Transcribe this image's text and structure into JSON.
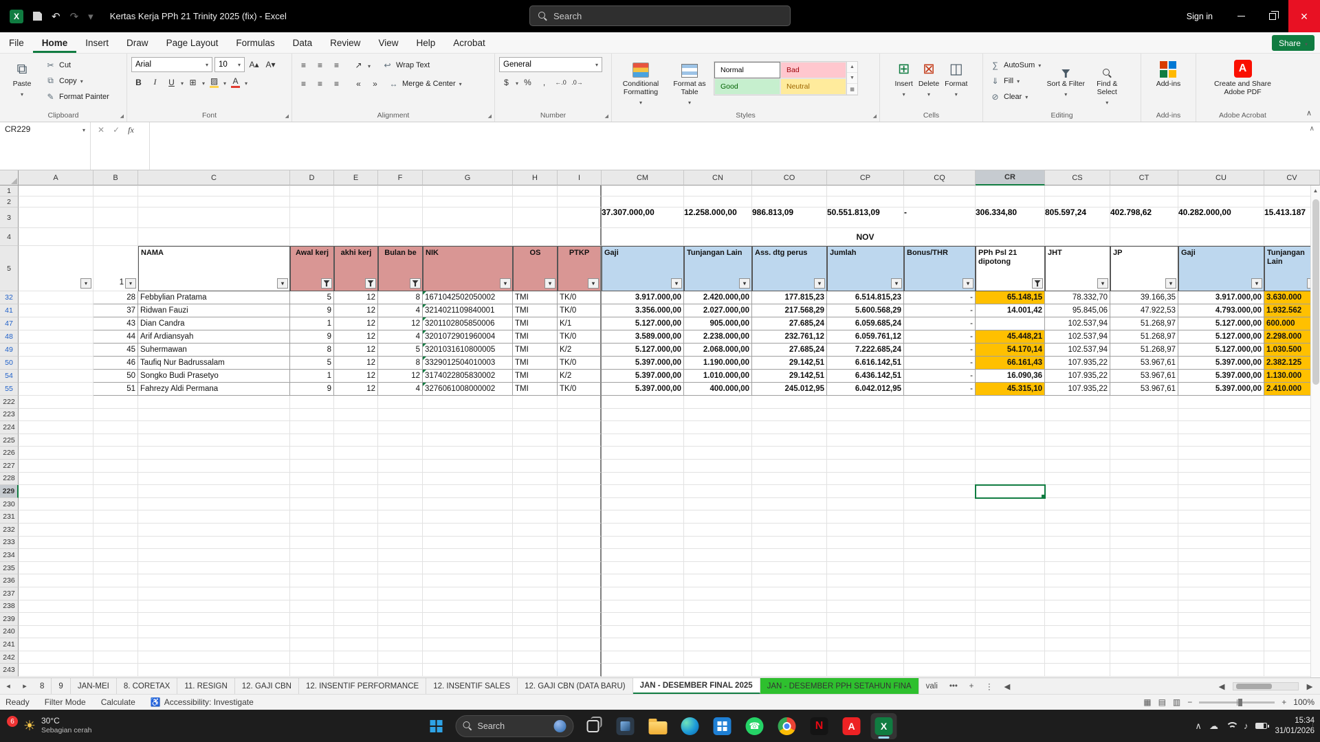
{
  "titlebar": {
    "title": "Kertas Kerja PPh 21 Trinity 2025 (fix)  -  Excel",
    "search_placeholder": "Search",
    "sign_in": "Sign in"
  },
  "menubar": {
    "items": [
      "File",
      "Home",
      "Insert",
      "Draw",
      "Page Layout",
      "Formulas",
      "Data",
      "Review",
      "View",
      "Help",
      "Acrobat"
    ],
    "active": "Home",
    "share": "Share"
  },
  "ribbon": {
    "clipboard": {
      "paste": "Paste",
      "cut": "Cut",
      "copy": "Copy",
      "format_painter": "Format Painter",
      "label": "Clipboard"
    },
    "font": {
      "name": "Arial",
      "size": "10",
      "label": "Font"
    },
    "alignment": {
      "wrap": "Wrap Text",
      "merge": "Merge & Center",
      "label": "Alignment"
    },
    "number": {
      "format": "General",
      "label": "Number"
    },
    "styles": {
      "conditional": "Conditional Formatting",
      "format_table": "Format as Table",
      "gallery": [
        "Normal",
        "Bad",
        "Good",
        "Neutral"
      ],
      "label": "Styles"
    },
    "cells": {
      "insert": "Insert",
      "delete": "Delete",
      "format": "Format",
      "label": "Cells"
    },
    "editing": {
      "autosum": "AutoSum",
      "fill": "Fill",
      "clear": "Clear",
      "sort": "Sort & Filter",
      "find": "Find & Select",
      "label": "Editing"
    },
    "addins": {
      "button": "Add-ins",
      "label": "Add-ins"
    },
    "adobe": {
      "button": "Create and Share Adobe PDF",
      "label": "Adobe Acrobat"
    }
  },
  "formula_bar": {
    "name_box": "CR229",
    "formula": ""
  },
  "sheet": {
    "columns": [
      "A",
      "B",
      "C",
      "D",
      "E",
      "F",
      "G",
      "H",
      "I",
      "CM",
      "CN",
      "CO",
      "CP",
      "CQ",
      "CR",
      "CS",
      "CT",
      "CU",
      "CV"
    ],
    "selection": {
      "col": "CR",
      "row": 229
    },
    "blank_rows": [
      "1",
      "2"
    ],
    "totals": {
      "row": "3",
      "values": {
        "CM": "37.307.000,00",
        "CN": "12.258.000,00",
        "CO": "986.813,09",
        "CP": "50.551.813,09",
        "CQ": "-",
        "CR": "306.334,80",
        "CS": "805.597,24",
        "CT": "402.798,62",
        "CU": "40.282.000,00",
        "CV": "15.413.187"
      }
    },
    "month": {
      "row": "4",
      "col": "CP",
      "label": "NOV"
    },
    "header": {
      "row": "5",
      "cells": [
        {
          "col": "A",
          "label": "",
          "style": "plain",
          "filter": "arrow"
        },
        {
          "col": "B",
          "label": "1",
          "style": "plain",
          "filter": "arrow"
        },
        {
          "col": "C",
          "label": "NAMA",
          "style": "white left",
          "filter": "arrow"
        },
        {
          "col": "D",
          "label": "Awal kerj",
          "style": "pink",
          "filter": "funnel"
        },
        {
          "col": "E",
          "label": "akhi kerj",
          "style": "pink",
          "filter": "funnel"
        },
        {
          "col": "F",
          "label": "Bulan be",
          "style": "pink",
          "filter": "funnel"
        },
        {
          "col": "G",
          "label": "NIK",
          "style": "pink left",
          "filter": "arrow"
        },
        {
          "col": "H",
          "label": "OS",
          "style": "pink",
          "filter": "arrow"
        },
        {
          "col": "I",
          "label": "PTKP",
          "style": "pink",
          "filter": "arrow"
        },
        {
          "col": "CM",
          "label": "Gaji",
          "style": "blue left",
          "filter": "arrow"
        },
        {
          "col": "CN",
          "label": "Tunjangan Lain",
          "style": "blue left",
          "filter": "arrow"
        },
        {
          "col": "CO",
          "label": "Ass. dtg perus",
          "style": "blue left",
          "filter": "arrow"
        },
        {
          "col": "CP",
          "label": "Jumlah",
          "style": "blue left",
          "filter": "arrow"
        },
        {
          "col": "CQ",
          "label": "Bonus/THR",
          "style": "blue left",
          "filter": "arrow"
        },
        {
          "col": "CR",
          "label": "PPh Psl 21 dipotong",
          "style": "white left",
          "filter": "funnel"
        },
        {
          "col": "CS",
          "label": "JHT",
          "style": "white left",
          "filter": "arrow"
        },
        {
          "col": "CT",
          "label": "JP",
          "style": "white left",
          "filter": "arrow"
        },
        {
          "col": "CU",
          "label": "Gaji",
          "style": "blue left",
          "filter": "arrow"
        },
        {
          "col": "CV",
          "label": "Tunjangan Lain",
          "style": "blue left",
          "filter": "arrow"
        }
      ]
    },
    "data_rows": [
      {
        "n": "32",
        "b": "28",
        "name": "Febbylian Pratama",
        "awal": "5",
        "akhir": "12",
        "bulan": "8",
        "nik": "1671042502050002",
        "os": "TMI",
        "ptkp": "TK/0",
        "gaji": "3.917.000,00",
        "tunj": "2.420.000,00",
        "ass": "177.815,23",
        "jumlah": "6.514.815,23",
        "bonus": "-",
        "pph": "65.148,15",
        "pph_orange": true,
        "jht": "78.332,70",
        "jp": "39.166,35",
        "gaji2": "3.917.000,00",
        "tunj2": "3.630.000",
        "tunj2_orange": true
      },
      {
        "n": "41",
        "b": "37",
        "name": "Ridwan Fauzi",
        "awal": "9",
        "akhir": "12",
        "bulan": "4",
        "nik": "3214021109840001",
        "os": "TMI",
        "ptkp": "TK/0",
        "gaji": "3.356.000,00",
        "tunj": "2.027.000,00",
        "ass": "217.568,29",
        "jumlah": "5.600.568,29",
        "bonus": "-",
        "pph": "14.001,42",
        "pph_orange": false,
        "jht": "95.845,06",
        "jp": "47.922,53",
        "gaji2": "4.793.000,00",
        "tunj2": "1.932.562",
        "tunj2_orange": true
      },
      {
        "n": "47",
        "b": "43",
        "name": "Dian Candra",
        "awal": "1",
        "akhir": "12",
        "bulan": "12",
        "nik": "3201102805850006",
        "os": "TMI",
        "ptkp": "K/1",
        "gaji": "5.127.000,00",
        "tunj": "905.000,00",
        "ass": "27.685,24",
        "jumlah": "6.059.685,24",
        "bonus": "-",
        "pph": "",
        "pph_orange": false,
        "jht": "102.537,94",
        "jp": "51.268,97",
        "gaji2": "5.127.000,00",
        "tunj2": "600.000",
        "tunj2_orange": true
      },
      {
        "n": "48",
        "b": "44",
        "name": "Arif Ardiansyah",
        "awal": "9",
        "akhir": "12",
        "bulan": "4",
        "nik": "3201072901960004",
        "os": "TMI",
        "ptkp": "TK/0",
        "gaji": "3.589.000,00",
        "tunj": "2.238.000,00",
        "ass": "232.761,12",
        "jumlah": "6.059.761,12",
        "bonus": "-",
        "pph": "45.448,21",
        "pph_orange": true,
        "jht": "102.537,94",
        "jp": "51.268,97",
        "gaji2": "5.127.000,00",
        "tunj2": "2.298.000",
        "tunj2_orange": true
      },
      {
        "n": "49",
        "b": "45",
        "name": "Suhermawan",
        "awal": "8",
        "akhir": "12",
        "bulan": "5",
        "nik": "3201031610800005",
        "os": "TMI",
        "ptkp": "K/2",
        "gaji": "5.127.000,00",
        "tunj": "2.068.000,00",
        "ass": "27.685,24",
        "jumlah": "7.222.685,24",
        "bonus": "-",
        "pph": "54.170,14",
        "pph_orange": true,
        "jht": "102.537,94",
        "jp": "51.268,97",
        "gaji2": "5.127.000,00",
        "tunj2": "1.030.500",
        "tunj2_orange": true
      },
      {
        "n": "50",
        "b": "46",
        "name": "Taufiq Nur Badrussalam",
        "awal": "5",
        "akhir": "12",
        "bulan": "8",
        "nik": "3329012504010003",
        "os": "TMI",
        "ptkp": "TK/0",
        "gaji": "5.397.000,00",
        "tunj": "1.190.000,00",
        "ass": "29.142,51",
        "jumlah": "6.616.142,51",
        "bonus": "-",
        "pph": "66.161,43",
        "pph_orange": true,
        "jht": "107.935,22",
        "jp": "53.967,61",
        "gaji2": "5.397.000,00",
        "tunj2": "2.382.125",
        "tunj2_orange": true
      },
      {
        "n": "54",
        "b": "50",
        "name": "Songko Budi Prasetyo",
        "awal": "1",
        "akhir": "12",
        "bulan": "12",
        "nik": "3174022805830002",
        "os": "TMI",
        "ptkp": "K/2",
        "gaji": "5.397.000,00",
        "tunj": "1.010.000,00",
        "ass": "29.142,51",
        "jumlah": "6.436.142,51",
        "bonus": "-",
        "pph": "16.090,36",
        "pph_orange": false,
        "jht": "107.935,22",
        "jp": "53.967,61",
        "gaji2": "5.397.000,00",
        "tunj2": "1.130.000",
        "tunj2_orange": true
      },
      {
        "n": "55",
        "b": "51",
        "name": "Fahrezy Aldi Permana",
        "awal": "9",
        "akhir": "12",
        "bulan": "4",
        "nik": "3276061008000002",
        "os": "TMI",
        "ptkp": "TK/0",
        "gaji": "5.397.000,00",
        "tunj": "400.000,00",
        "ass": "245.012,95",
        "jumlah": "6.042.012,95",
        "bonus": "-",
        "pph": "45.315,10",
        "pph_orange": true,
        "jht": "107.935,22",
        "jp": "53.967,61",
        "gaji2": "5.397.000,00",
        "tunj2": "2.410.000",
        "tunj2_orange": true
      }
    ],
    "empty_rows": {
      "from": 222,
      "to": 243
    }
  },
  "tabbar": {
    "tabs": [
      {
        "label": "8"
      },
      {
        "label": "9"
      },
      {
        "label": "JAN-MEI"
      },
      {
        "label": "8. CORETAX"
      },
      {
        "label": "11. RESIGN"
      },
      {
        "label": "12. GAJI CBN"
      },
      {
        "label": "12. INSENTIF PERFORMANCE"
      },
      {
        "label": "12. INSENTIF SALES"
      },
      {
        "label": "12. GAJI CBN (DATA BARU)"
      },
      {
        "label": "JAN - DESEMBER FINAL 2025",
        "active": true
      },
      {
        "label": "JAN - DESEMBER PPH SETAHUN FINA",
        "color": "green"
      },
      {
        "label": "vali",
        "partial": true
      }
    ]
  },
  "statusbar": {
    "items": [
      "Ready",
      "Filter Mode",
      "Calculate"
    ],
    "accessibility": "Accessibility: Investigate",
    "zoom": "100%"
  },
  "taskbar": {
    "badge": "6",
    "weather_temp": "30°C",
    "weather_desc": "Sebagian cerah",
    "search": "Search",
    "time": "15:34",
    "date": "31/01/2026"
  },
  "colors": {
    "accent_green": "#107c41",
    "header_pink": "#d99694",
    "header_blue": "#bdd7ee",
    "cell_orange": "#ffc000",
    "tab_green": "#2ec02e",
    "close_red": "#e81123"
  },
  "icons": {
    "excel_logo": "X",
    "undo": "↶",
    "redo": "↷",
    "caret_down": "▾",
    "cut": "✂",
    "copy": "⧉",
    "format_painter": "✎",
    "bold": "B",
    "italic": "I",
    "underline": "U",
    "borders": "⊞",
    "fill_color": "▨",
    "font_color": "A",
    "grow_font": "A▴",
    "shrink_font": "A▾",
    "align_bars": "≡",
    "orientation": "↗",
    "wrap_text": "↩",
    "merge_center": "↔",
    "indent_left": "«",
    "indent_right": "»",
    "accounting": "$",
    "percent": "%",
    "comma": ",",
    "decimal_increase": "←.0",
    "decimal_decrease": ".0→",
    "insert_cells": "⊞",
    "delete_cells": "⊠",
    "format_cells": "◫",
    "autosum": "∑",
    "fill_down": "⇓",
    "clear": "⊘",
    "fx": "fx",
    "check": "✓",
    "cancel": "✕",
    "accessibility": "♿",
    "view_normal": "▦",
    "view_layout": "▤",
    "view_break": "▥",
    "minus": "−",
    "plus": "+",
    "nav_left": "◂",
    "nav_right": "▸",
    "scroll_left": "◀",
    "scroll_right": "▶",
    "ellipsis": "•••",
    "kebab": "⋮",
    "collapse": "∧",
    "up_arrow": "▲",
    "down_arrow": "▼",
    "tray_chevron": "∧",
    "onedrive_cloud": "☁",
    "sun": "☀",
    "volume": "♪",
    "phone": "☎",
    "netflix_letter": "N",
    "acrobat_letter": "A",
    "excel_letter": "X",
    "powerpoint_letter": "P"
  }
}
